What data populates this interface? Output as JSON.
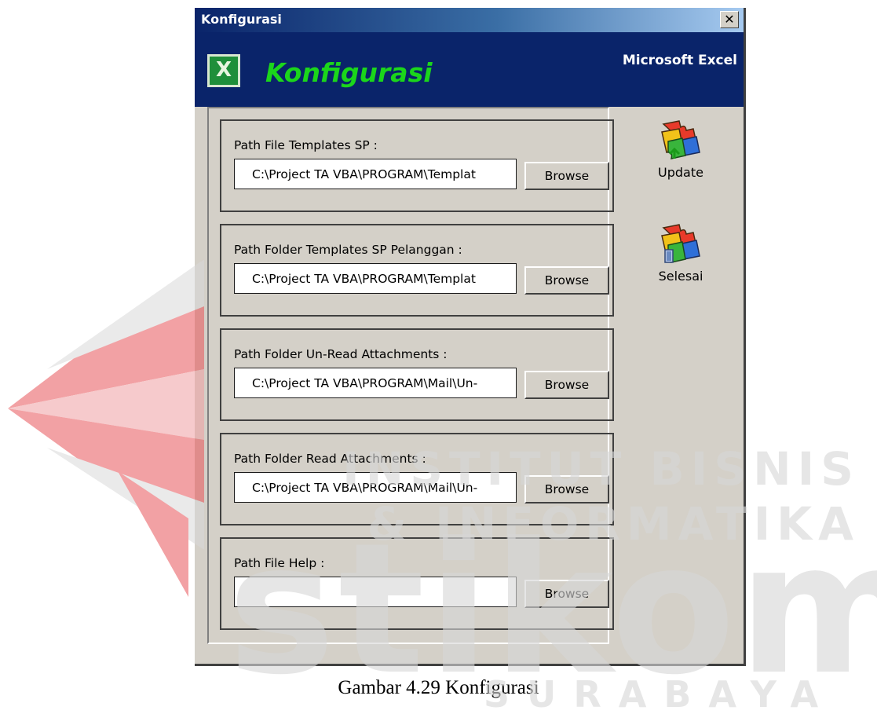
{
  "window": {
    "title": "Konfigurasi"
  },
  "banner": {
    "title": "Konfigurasi",
    "app_name": "Microsoft Excel",
    "logo_icon": "excel-icon",
    "colors": {
      "banner": "#0a246a",
      "title": "#1bd61b"
    }
  },
  "groups": [
    {
      "label": "Path File Templates SP :",
      "value": "C:\\Project TA VBA\\PROGRAM\\Templat",
      "button": "Browse"
    },
    {
      "label": "Path Folder Templates SP Pelanggan :",
      "value": "C:\\Project TA VBA\\PROGRAM\\Templat",
      "button": "Browse"
    },
    {
      "label": "Path Folder Un-Read Attachments :",
      "value": "C:\\Project TA VBA\\PROGRAM\\Mail\\Un-",
      "button": "Browse"
    },
    {
      "label": "Path Folder Read Attachments :",
      "value": "C:\\Project TA VBA\\PROGRAM\\Mail\\Un-",
      "button": "Browse"
    },
    {
      "label": "Path File Help :",
      "value": "",
      "button": "Browse"
    }
  ],
  "actions": {
    "update": {
      "label": "Update",
      "icon": "puzzle-update-icon"
    },
    "selesai": {
      "label": "Selesai",
      "icon": "puzzle-exit-icon"
    }
  },
  "caption": "Gambar 4.29 Konfigurasi",
  "watermark": {
    "line1": "INSTITUT BISNIS",
    "line2": "& INFORMATIKA",
    "line3": "stikom",
    "line4": "SURABAYA",
    "color": "#d0d0d0",
    "accent": "#e8555a"
  }
}
